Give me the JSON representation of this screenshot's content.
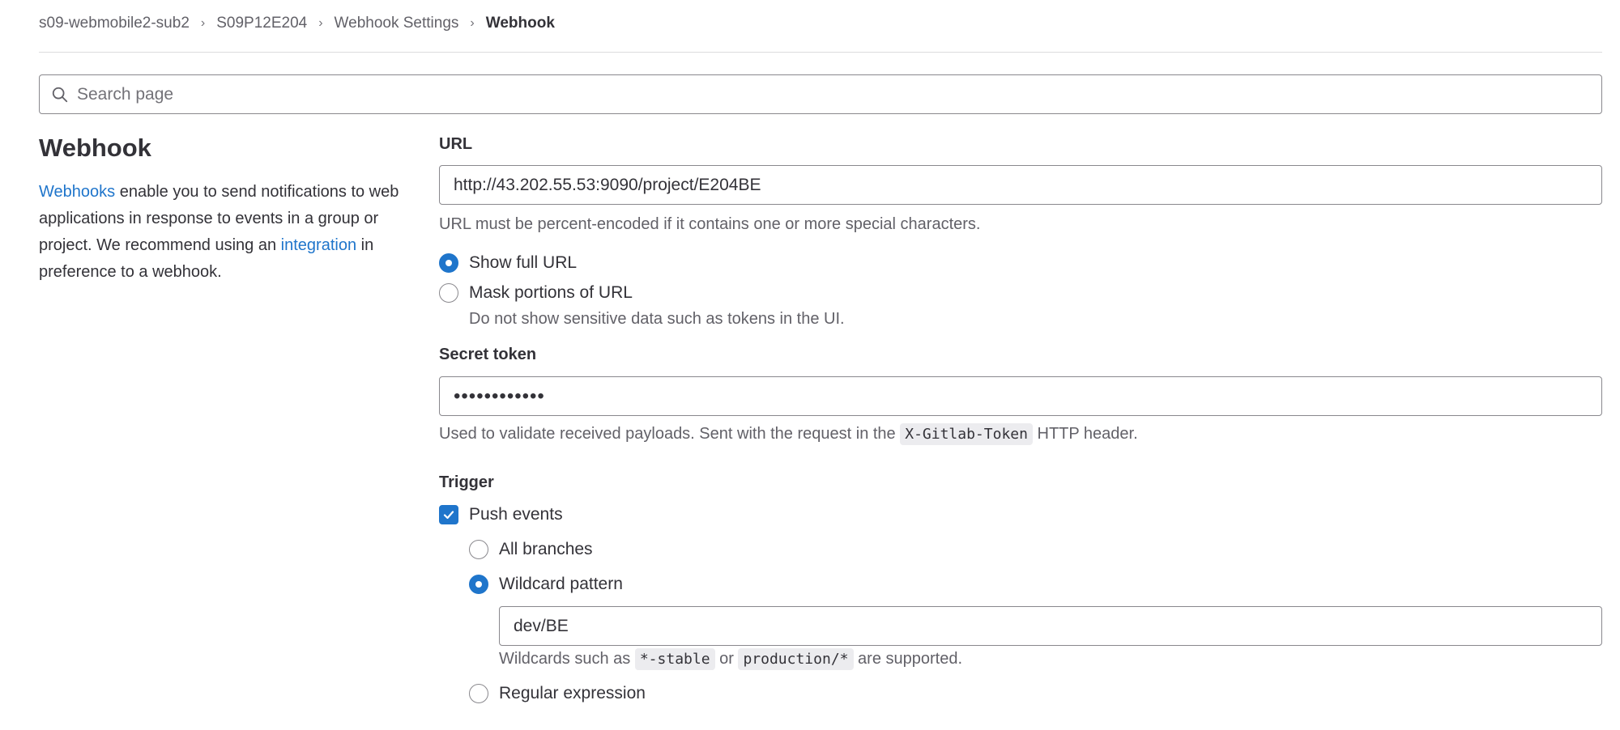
{
  "breadcrumb": [
    {
      "label": "s09-webmobile2-sub2"
    },
    {
      "label": "S09P12E204"
    },
    {
      "label": "Webhook Settings"
    },
    {
      "label": "Webhook"
    }
  ],
  "search": {
    "placeholder": "Search page",
    "icon": "search-icon"
  },
  "sidebar": {
    "title": "Webhook",
    "description": {
      "link1": "Webhooks",
      "text1": " enable you to send notifications to web applications in response to events in a group or project. We recommend using an ",
      "link2": "integration",
      "text2": " in preference to a webhook."
    }
  },
  "url": {
    "label": "URL",
    "value": "http://43.202.55.53:9090/project/E204BE",
    "help": "URL must be percent-encoded if it contains one or more special characters.",
    "options": [
      {
        "label": "Show full URL",
        "checked": true
      },
      {
        "label": "Mask portions of URL",
        "checked": false,
        "help": "Do not show sensitive data such as tokens in the UI."
      }
    ]
  },
  "secret": {
    "label": "Secret token",
    "value": "••••••••••••",
    "help_prefix": "Used to validate received payloads. Sent with the request in the ",
    "help_code": "X-Gitlab-Token",
    "help_suffix": " HTTP header."
  },
  "trigger": {
    "label": "Trigger",
    "push_events": {
      "label": "Push events",
      "checked": true
    },
    "branch_options": [
      {
        "label": "All branches",
        "checked": false
      },
      {
        "label": "Wildcard pattern",
        "checked": true
      },
      {
        "label": "Regular expression",
        "checked": false
      }
    ],
    "wildcard_value": "dev/BE",
    "wildcard_help": {
      "prefix": "Wildcards such as ",
      "code1": "*-stable",
      "middle": " or ",
      "code2": "production/*",
      "suffix": " are supported."
    }
  },
  "colors": {
    "accent": "#1f75cb",
    "text": "#333238",
    "muted": "#626168",
    "border": "#89888d"
  }
}
